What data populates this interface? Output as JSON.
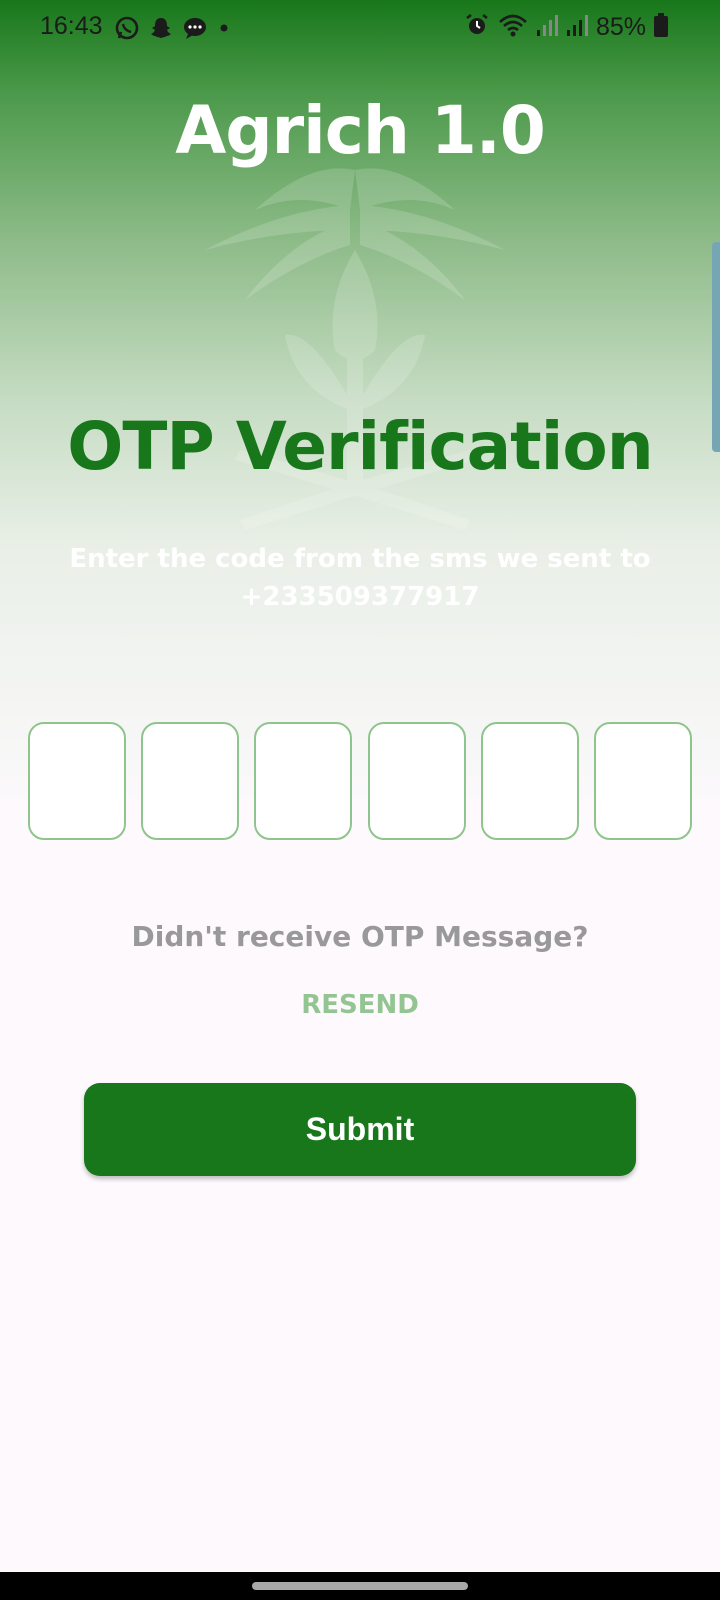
{
  "status_bar": {
    "time": "16:43",
    "battery": "85%",
    "icons": [
      "whatsapp-icon",
      "snapchat-icon",
      "message-icon",
      "dot-icon",
      "alarm-icon",
      "wifi-icon",
      "signal-icon",
      "signal-icon",
      "battery-icon"
    ]
  },
  "app": {
    "title": "Agrich 1.0"
  },
  "otp": {
    "heading": "OTP Verification",
    "instruction": "Enter the code from the sms we sent to +233509377917",
    "digits": [
      "",
      "",
      "",
      "",
      "",
      ""
    ]
  },
  "resend": {
    "question": "Didn't receive OTP Message?",
    "link_label": "RESEND"
  },
  "submit": {
    "label": "Submit"
  },
  "colors": {
    "primary_green": "#18771a",
    "light_green": "#93c592",
    "gray_text": "#999999",
    "background": "#fdf9fd"
  }
}
